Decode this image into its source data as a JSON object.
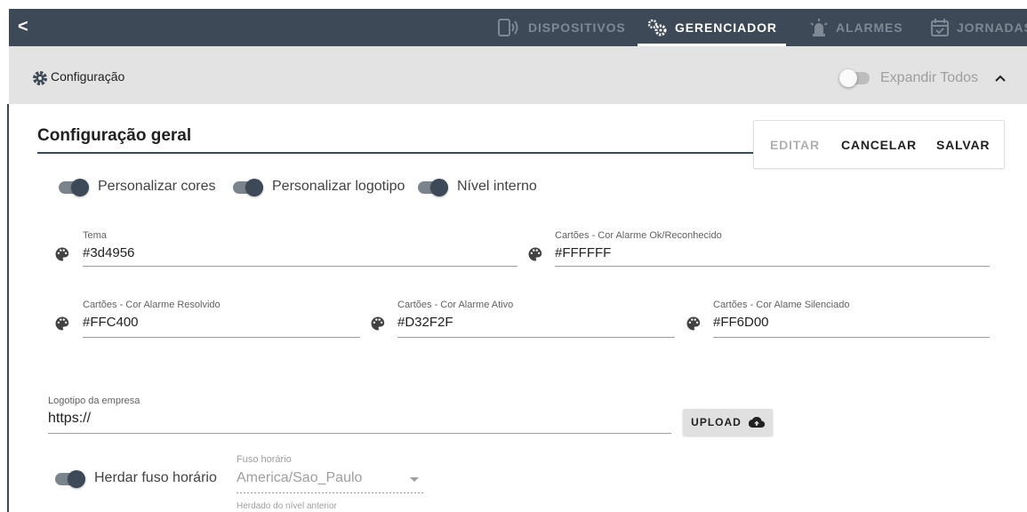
{
  "nav": {
    "back_glyph": "<",
    "tabs": [
      {
        "label": "DISPOSITIVOS",
        "icon": "device-icon",
        "active": false
      },
      {
        "label": "GERENCIADOR",
        "icon": "gears-icon",
        "active": true
      },
      {
        "label": "ALARMES",
        "icon": "alarm-light-icon",
        "active": false
      },
      {
        "label": "JORNADAS",
        "icon": "calendar-check-icon",
        "active": false
      }
    ]
  },
  "section": {
    "title": "Configuração",
    "expand_all_label": "Expandir Todos",
    "expand_all_on": false
  },
  "card": {
    "title": "Configuração geral",
    "actions": {
      "edit": "EDITAR",
      "cancel": "CANCELAR",
      "save": "SALVAR"
    },
    "switches": [
      {
        "label": "Personalizar cores",
        "on": true
      },
      {
        "label": "Personalizar logotipo",
        "on": true
      },
      {
        "label": "Nível interno",
        "on": true
      }
    ],
    "fields": {
      "theme": {
        "label": "Tema",
        "value": "#3d4956"
      },
      "ok_color": {
        "label": "Cartões - Cor Alarme Ok/Reconhecido",
        "value": "#FFFFFF"
      },
      "resolved_color": {
        "label": "Cartões - Cor Alarme Resolvido",
        "value": "#FFC400"
      },
      "active_color": {
        "label": "Cartões - Cor Alarme Ativo",
        "value": "#D32F2F"
      },
      "silenced_color": {
        "label": "Cartões - Cor Alame Silenciado",
        "value": "#FF6D00"
      },
      "logo": {
        "label": "Logotipo da empresa",
        "value": "https://"
      }
    },
    "upload_label": "UPLOAD",
    "timezone": {
      "inherit_label": "Herdar fuso horário",
      "inherit_on": true,
      "label": "Fuso horário",
      "value": "America/Sao_Paulo",
      "hint": "Herdado do nível anterior"
    }
  },
  "colors": {
    "primary": "#3d4956",
    "tab_inactive": "#7f8893",
    "section_bg": "#e3e3e3"
  }
}
